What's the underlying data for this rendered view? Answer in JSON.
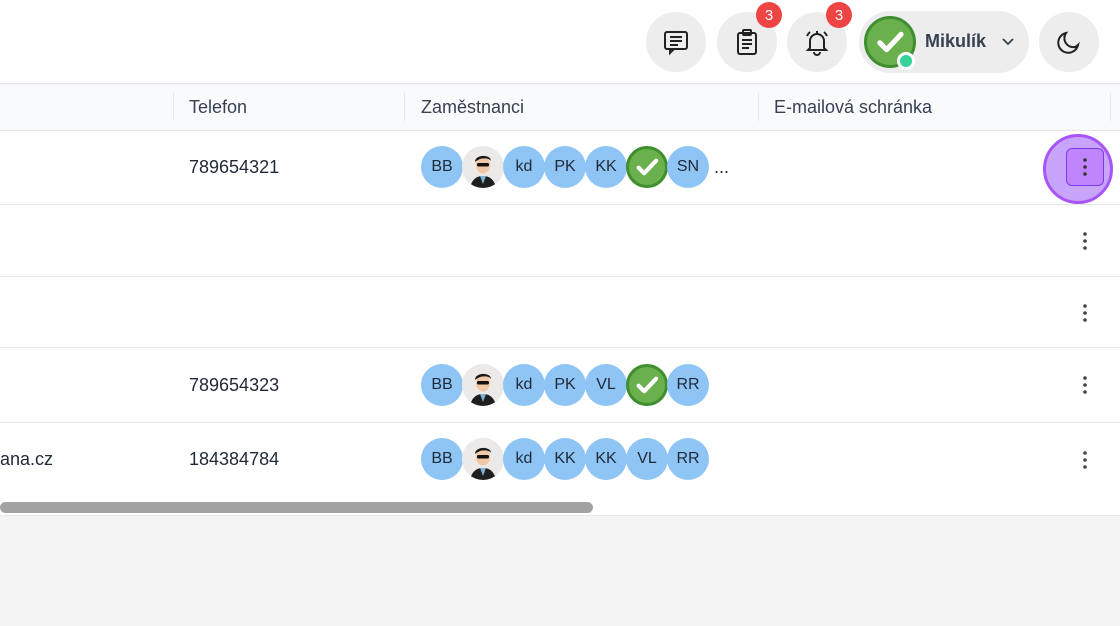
{
  "header": {
    "messages_icon": "chat-lines-icon",
    "tasks_icon": "clipboard-icon",
    "tasks_badge": "3",
    "notifications_icon": "bell-icon",
    "notifications_badge": "3",
    "user_name": "Mikulík",
    "theme_icon": "moon-icon"
  },
  "table": {
    "columns": [
      "Telefon",
      "Zaměstnanci",
      "E-mailová schránka"
    ],
    "rows": [
      {
        "prefix": "",
        "phone": "789654321",
        "employees": [
          "BB",
          "photo",
          "kd",
          "PK",
          "KK",
          "check",
          "SN"
        ],
        "overflow": "...",
        "email": ""
      },
      {
        "prefix": "",
        "phone": "",
        "employees": [],
        "overflow": "",
        "email": ""
      },
      {
        "prefix": "",
        "phone": "",
        "employees": [],
        "overflow": "",
        "email": ""
      },
      {
        "prefix": "",
        "phone": "789654323",
        "employees": [
          "BB",
          "photo",
          "kd",
          "PK",
          "VL",
          "check",
          "RR"
        ],
        "overflow": "",
        "email": ""
      },
      {
        "prefix": "ana.cz",
        "phone": "184384784",
        "employees": [
          "BB",
          "photo",
          "kd",
          "KK",
          "KK",
          "VL",
          "RR"
        ],
        "overflow": "",
        "email": ""
      }
    ]
  },
  "colors": {
    "avatar_blue": "#8ec5f5",
    "check_green": "#6ab04c",
    "badge_red": "#ef4444",
    "highlight_purple": "#c084fc"
  }
}
